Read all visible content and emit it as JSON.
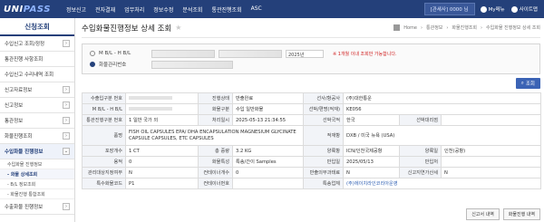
{
  "app": {
    "logo_main": "UNI",
    "logo_accent": "PASS"
  },
  "nav": [
    "정보신고",
    "전자결재",
    "업무처리",
    "정보수정",
    "분석조회",
    "통관진행조회",
    "ASC"
  ],
  "topright": {
    "login": "[관세사] 0000 님",
    "my_menu": "My메뉴",
    "sitemap": "사이트맵"
  },
  "sidebar": {
    "title": "신청조회",
    "items": [
      {
        "label": "수입신고 조회/정정"
      },
      {
        "label": "통관진행 사항조회"
      },
      {
        "label": "수입신고 수리내역 조회"
      },
      {
        "label": "신고자료정보"
      },
      {
        "label": "신고정보"
      },
      {
        "label": "통관정보"
      },
      {
        "label": "화물진행조회"
      },
      {
        "label": "수입화물 진행정보"
      }
    ],
    "subs": [
      "수입화물 진행정보",
      "- 화물 상세조회",
      "- B/L 정보조회",
      "- 화물진행 통합조회"
    ],
    "footer_items": [
      "수출화물 진행정보"
    ]
  },
  "main": {
    "title": "수입화물진행정보 상세 조회",
    "breadcrumb": [
      "Home",
      "통관정보",
      "화물진행조회",
      "수입화물 진행정보 상세 조회"
    ],
    "search": {
      "opt1": "M B/L - H B/L",
      "opt2": "화물관리번호",
      "year_select": "2025년",
      "hint": "※ 1개월 이내 조회만 가능합니다."
    },
    "search_button": "조회",
    "rows": [
      [
        {
          "l": "수출입구분 번호"
        },
        {
          "v": "",
          "blur": true
        },
        {
          "l": "진행상태"
        },
        {
          "v": "반출완료"
        },
        {
          "l": "선사/항공사"
        },
        {
          "v": "(주)대한통운"
        }
      ],
      [
        {
          "l": "M B/L - H B/L"
        },
        {
          "v": "",
          "blur": true
        },
        {
          "l": "화물구분"
        },
        {
          "v": "수입 일반화물"
        },
        {
          "l": "선박/편명(적재)"
        },
        {
          "v": "KE056"
        }
      ],
      [
        {
          "l": "통관진행구분 번호"
        },
        {
          "v": "1 일반 국가 외"
        },
        {
          "l": "처리일시"
        },
        {
          "v": "2025-05-13 21:34:55"
        },
        {
          "l": "선박국적"
        },
        {
          "v": "한국"
        },
        {
          "l": "선박대리점"
        },
        {
          "v": ""
        }
      ],
      [
        {
          "l": "품명"
        },
        {
          "v": "FISH OIL CAPSULES EPA/ DHA ENCAPSULATION MAGNESIUM GLYCINATE CAPSULE CAPSULES, ETC CAPSULES"
        },
        {
          "l": "적재항"
        },
        {
          "v": "DXB / 미국 뉴욕 (USA)"
        }
      ],
      [
        {
          "l": "포장개수"
        },
        {
          "v": "1 CT"
        },
        {
          "l": "총 중량"
        },
        {
          "v": "3.2 KG"
        },
        {
          "l": "양륙항"
        },
        {
          "v": "ICN/인천국제공항"
        },
        {
          "l": "양륙일"
        },
        {
          "v": "인천(공항)"
        }
      ],
      [
        {
          "l": "용적"
        },
        {
          "v": "0"
        },
        {
          "l": "화물특성"
        },
        {
          "v": "특송/간이 Samples"
        },
        {
          "l": "반입일"
        },
        {
          "v": "2025/05/13"
        },
        {
          "l": "반입처"
        },
        {
          "v": ""
        }
      ],
      [
        {
          "l": "관리대상지정여부"
        },
        {
          "v": "N"
        },
        {
          "l": "컨테이너개수"
        },
        {
          "v": "0"
        },
        {
          "l": "반출의무과태료"
        },
        {
          "v": "N"
        },
        {
          "l": "신고지연가산세"
        },
        {
          "v": "N"
        }
      ],
      [
        {
          "l": "특수화물코드"
        },
        {
          "v": "P1"
        },
        {
          "l": "컨테이너번호"
        },
        {
          "v": ""
        },
        {
          "l": "특송업체"
        },
        {
          "v": "(주)에이치라인코리아운영",
          "link": true
        }
      ]
    ],
    "bottom_buttons": [
      "신고서 내역",
      "화물진행 내역"
    ]
  }
}
